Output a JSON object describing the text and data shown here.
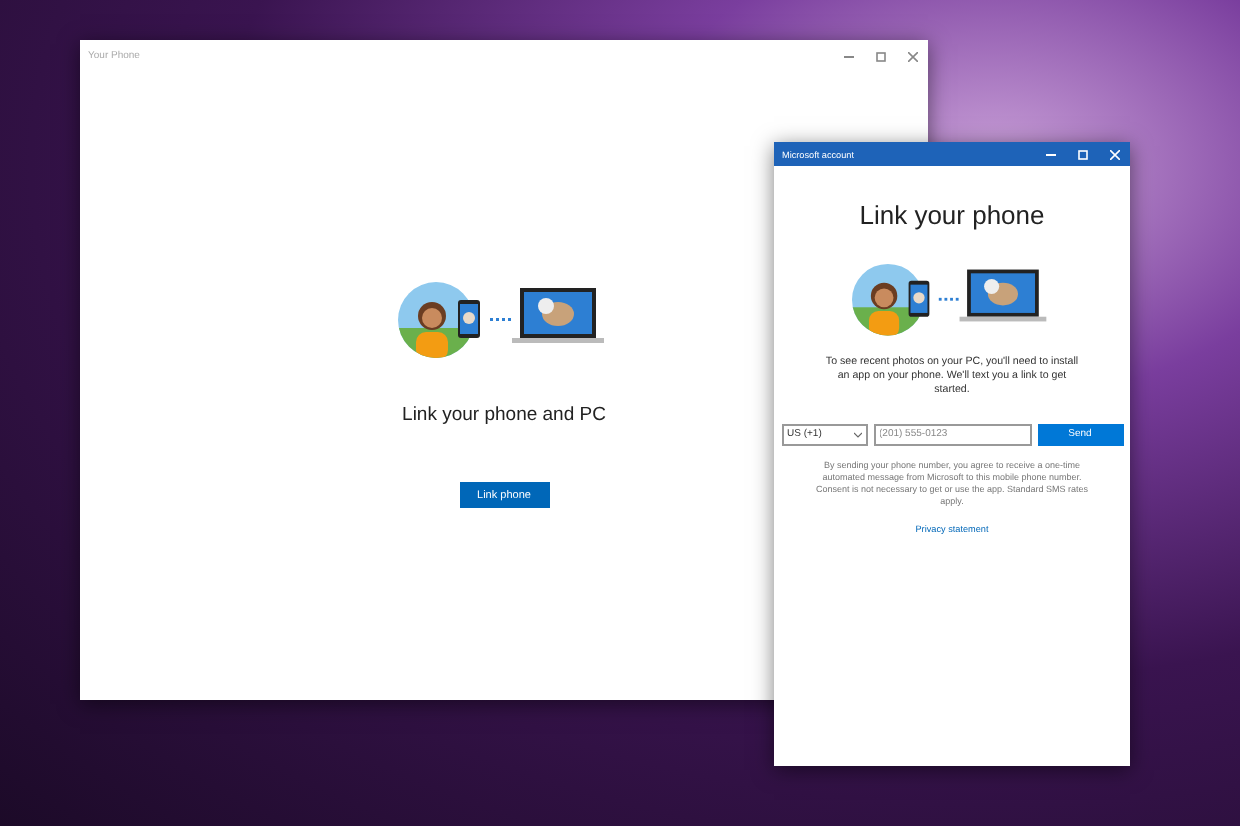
{
  "main_window": {
    "title": "Your Phone",
    "heading": "Link your phone and PC",
    "button": "Link phone"
  },
  "dialog": {
    "title": "Microsoft account",
    "heading": "Link your phone",
    "description": "To see recent photos on your PC, you'll need to install an app on your phone. We'll text you a link to get started.",
    "country_select": {
      "value": "US (+1)"
    },
    "phone_field": {
      "placeholder": "(201) 555-0123"
    },
    "send_button": "Send",
    "disclaimer": "By sending your phone number, you agree to receive a one-time automated message from Microsoft to this mobile phone number. Consent is not necessary to get or use the app. Standard SMS rates apply.",
    "privacy_link": "Privacy statement"
  }
}
